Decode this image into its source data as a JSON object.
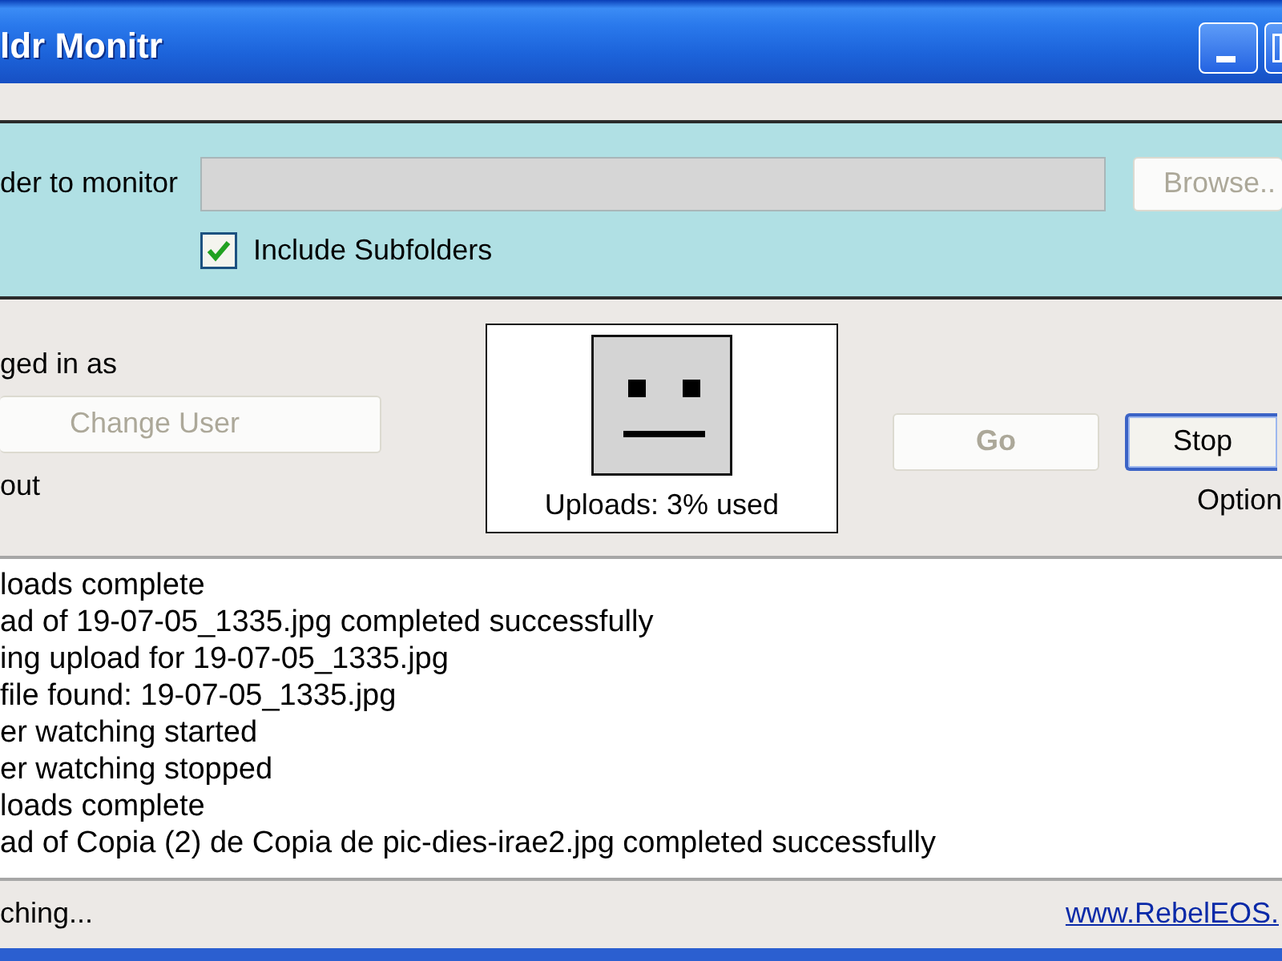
{
  "window": {
    "title": "ldr Monitr",
    "controls": [
      {
        "kind": "minimize"
      },
      {
        "kind": "maximize"
      }
    ]
  },
  "folder_panel": {
    "label": "der to monitor",
    "folder_field": {
      "disabled": true
    },
    "browse_button": {
      "label": "Browse..",
      "disabled": true
    },
    "include_subfolders": {
      "label": "Include Subfolders",
      "checked": true
    }
  },
  "account": {
    "label": "ged in as",
    "change_user_button": {
      "label": "Change User",
      "disabled": true
    },
    "link": "out"
  },
  "quota": {
    "text": "Uploads: 3% used"
  },
  "buttons": [
    {
      "label": "Go",
      "disabled": true,
      "default": false
    },
    {
      "label": "Stop",
      "disabled": false,
      "default": true
    }
  ],
  "options_link": "Option",
  "log": [
    "loads complete",
    "ad of 19-07-05_1335.jpg completed successfully",
    "ing upload for 19-07-05_1335.jpg",
    "file found: 19-07-05_1335.jpg",
    "er watching started",
    "er watching stopped",
    "loads complete",
    "ad of Copia (2) de Copia de pic-dies-irae2.jpg completed successfully"
  ],
  "status_bar": {
    "text": "ching...",
    "link": "www.RebelEOS."
  }
}
